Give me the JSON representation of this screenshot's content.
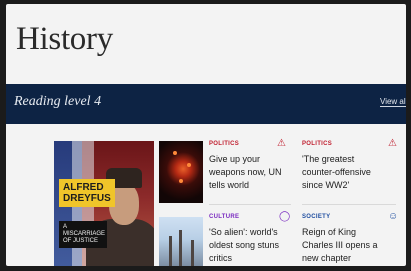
{
  "page": {
    "title": "History"
  },
  "banner": {
    "title": "Reading level 4",
    "link": "View all in th"
  },
  "hero": {
    "tag": "ALFRED DREYFUS",
    "subtag": "A MISCARRIAGE OF JUSTICE"
  },
  "articles": [
    {
      "category": "POLITICS",
      "headline": "Give up your weapons now, UN tells world",
      "icon": "politics-figure-icon"
    },
    {
      "category": "POLITICS",
      "headline": "'The greatest counter-offensive since WW2'",
      "icon": "politics-figure-icon"
    },
    {
      "category": "CULTURE",
      "headline": "'So alien': world's oldest song stuns critics",
      "icon": "culture-mask-icon"
    },
    {
      "category": "SOCIETY",
      "headline": "Reign of King Charles III opens a new chapter",
      "icon": "society-person-icon"
    }
  ]
}
